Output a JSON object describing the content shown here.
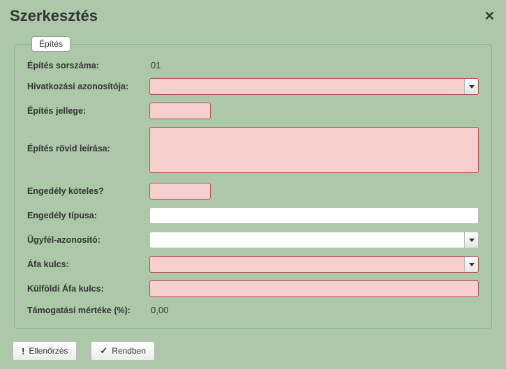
{
  "dialog": {
    "title": "Szerkesztés"
  },
  "fieldset": {
    "legend": "Építés"
  },
  "fields": {
    "seq": {
      "label": "Építés sorszáma:",
      "value": "01"
    },
    "ref": {
      "label": "Hivatkozási azonosítója:",
      "value": ""
    },
    "type": {
      "label": "Építés jellege:",
      "value": ""
    },
    "desc": {
      "label": "Építés rövid leírása:",
      "value": ""
    },
    "permit": {
      "label": "Engedély köteles?",
      "value": ""
    },
    "permit_type": {
      "label": "Engedély típusa:",
      "value": ""
    },
    "client_id": {
      "label": "Ügyfél-azonosító:",
      "value": ""
    },
    "vat": {
      "label": "Áfa kulcs:",
      "value": ""
    },
    "foreign_vat": {
      "label": "Külföldi Áfa kulcs:",
      "value": ""
    },
    "support": {
      "label": "Támogatási mértéke (%):",
      "value": "0,00"
    }
  },
  "buttons": {
    "check": "Ellenőrzés",
    "ok": "Rendben"
  }
}
